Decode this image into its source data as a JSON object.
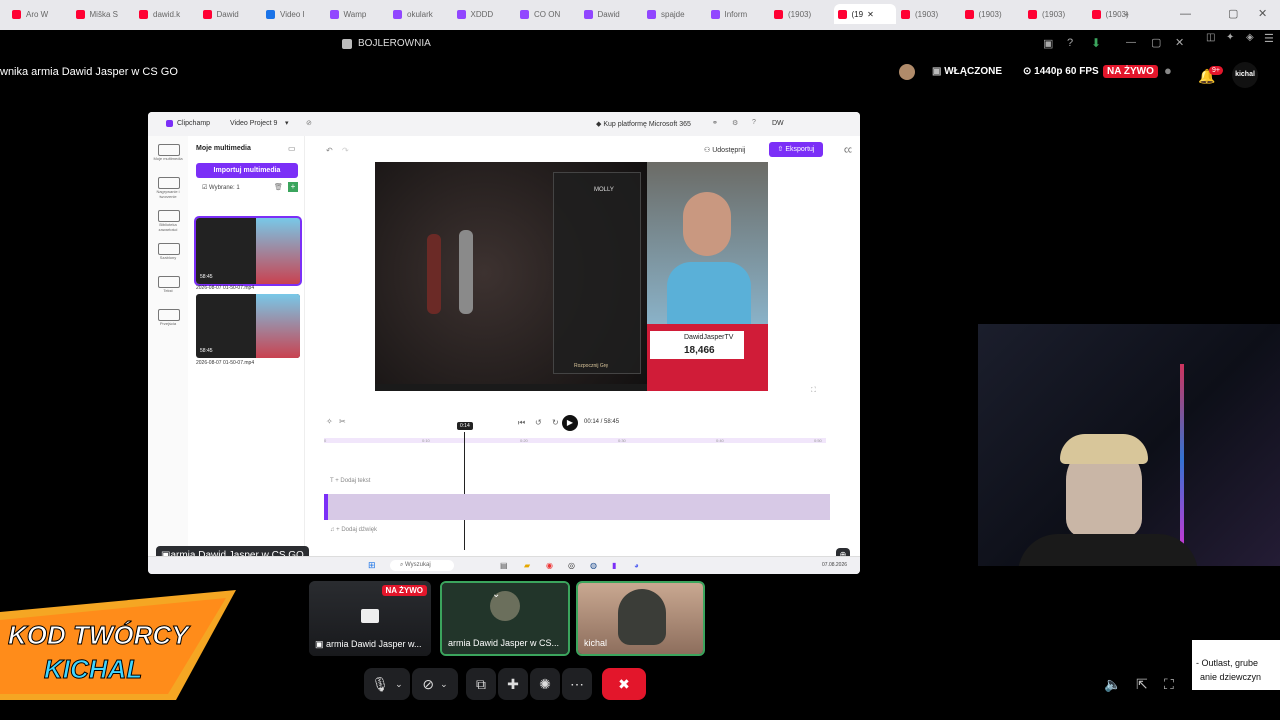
{
  "browser_tabs": [
    {
      "label": "Aro W",
      "color": "#ff0033"
    },
    {
      "label": "Miška S",
      "color": "#ff0033"
    },
    {
      "label": "dawid.k",
      "color": "#ff0033"
    },
    {
      "label": "Dawid",
      "color": "#ff0033"
    },
    {
      "label": "Video I",
      "color": "#1a73e8"
    },
    {
      "label": "Wamp",
      "color": "#9146ff"
    },
    {
      "label": "okulark",
      "color": "#9146ff"
    },
    {
      "label": "XDDD",
      "color": "#9146ff"
    },
    {
      "label": "CO ON",
      "color": "#9146ff"
    },
    {
      "label": "Dawid",
      "color": "#9146ff"
    },
    {
      "label": "spajde",
      "color": "#9146ff"
    },
    {
      "label": "Inform",
      "color": "#9146ff"
    },
    {
      "label": "(1903)",
      "color": "#ff0033"
    },
    {
      "label": "(19",
      "color": "#ff0033"
    },
    {
      "label": "(1903)",
      "color": "#ff0033"
    },
    {
      "label": "(1903)",
      "color": "#ff0033"
    },
    {
      "label": "(1903)",
      "color": "#ff0033"
    },
    {
      "label": "(1903)",
      "color": "#ff0033"
    }
  ],
  "window": {
    "title": "BOJLEROWNIA"
  },
  "stream": {
    "title": "wnika armia Dawid Jasper w CS GO",
    "status": "WŁĄCZONE",
    "quality": "1440p 60 FPS",
    "live_badge": "NA ŻYWO",
    "notif_count": "9+",
    "user_short": "kichal"
  },
  "clipchamp": {
    "app": "Clipchamp",
    "project": "Video Project 9",
    "ms365": "Kup platformę Microsoft 365",
    "user_initials": "DW",
    "panel_title": "Moje multimedia",
    "import_label": "Importuj multimedia",
    "selected_label": "Wybrane: 1",
    "rail": [
      "Moje multimedia",
      "Nagrywanie i tworzenie",
      "Biblioteka zawartości",
      "Szablony",
      "Tekst",
      "Przejścia"
    ],
    "clips": [
      {
        "duration": "58:45",
        "name": "2026-08-07 01-50-07.mp4"
      },
      {
        "duration": "58:45",
        "name": "2026-08-07 01-50-07.mp4"
      }
    ],
    "share_label": "Udostępnij",
    "export_label": "Eksportuj",
    "preview_channel": "DawidJasperTV",
    "preview_count": "18,466",
    "game_char": "MOLLY",
    "game_start": "Rozpocznij Grę",
    "playhead": "0:14",
    "time_display": "00:14 / 58:45",
    "ruler": [
      "0",
      "0:10",
      "0:20",
      "0:30",
      "0:40",
      "0:50"
    ],
    "add_text": "+ Dodaj tekst",
    "add_audio": "+ Dodaj dźwięk",
    "search_placeholder": "Wyszukaj",
    "share_caption": "armia Dawid Jasper w CS GO",
    "taskbar_date": "07.08.2026"
  },
  "participants": [
    {
      "name": "armia Dawid Jasper w...",
      "badge": "NA ŻYWO"
    },
    {
      "name": "armia Dawid Jasper w CS...",
      "badge": ""
    },
    {
      "name": "kichal",
      "badge": ""
    }
  ],
  "overlay": {
    "line1": "KOD TWÓRCY",
    "line2": "KICHAL"
  },
  "side_chat": {
    "line1": "- Outlast, grube",
    "line2": "anie dziewczyn"
  },
  "colors": {
    "accent": "#7b2ff7",
    "live": "#e3162b",
    "end_call": "#e3162b"
  }
}
